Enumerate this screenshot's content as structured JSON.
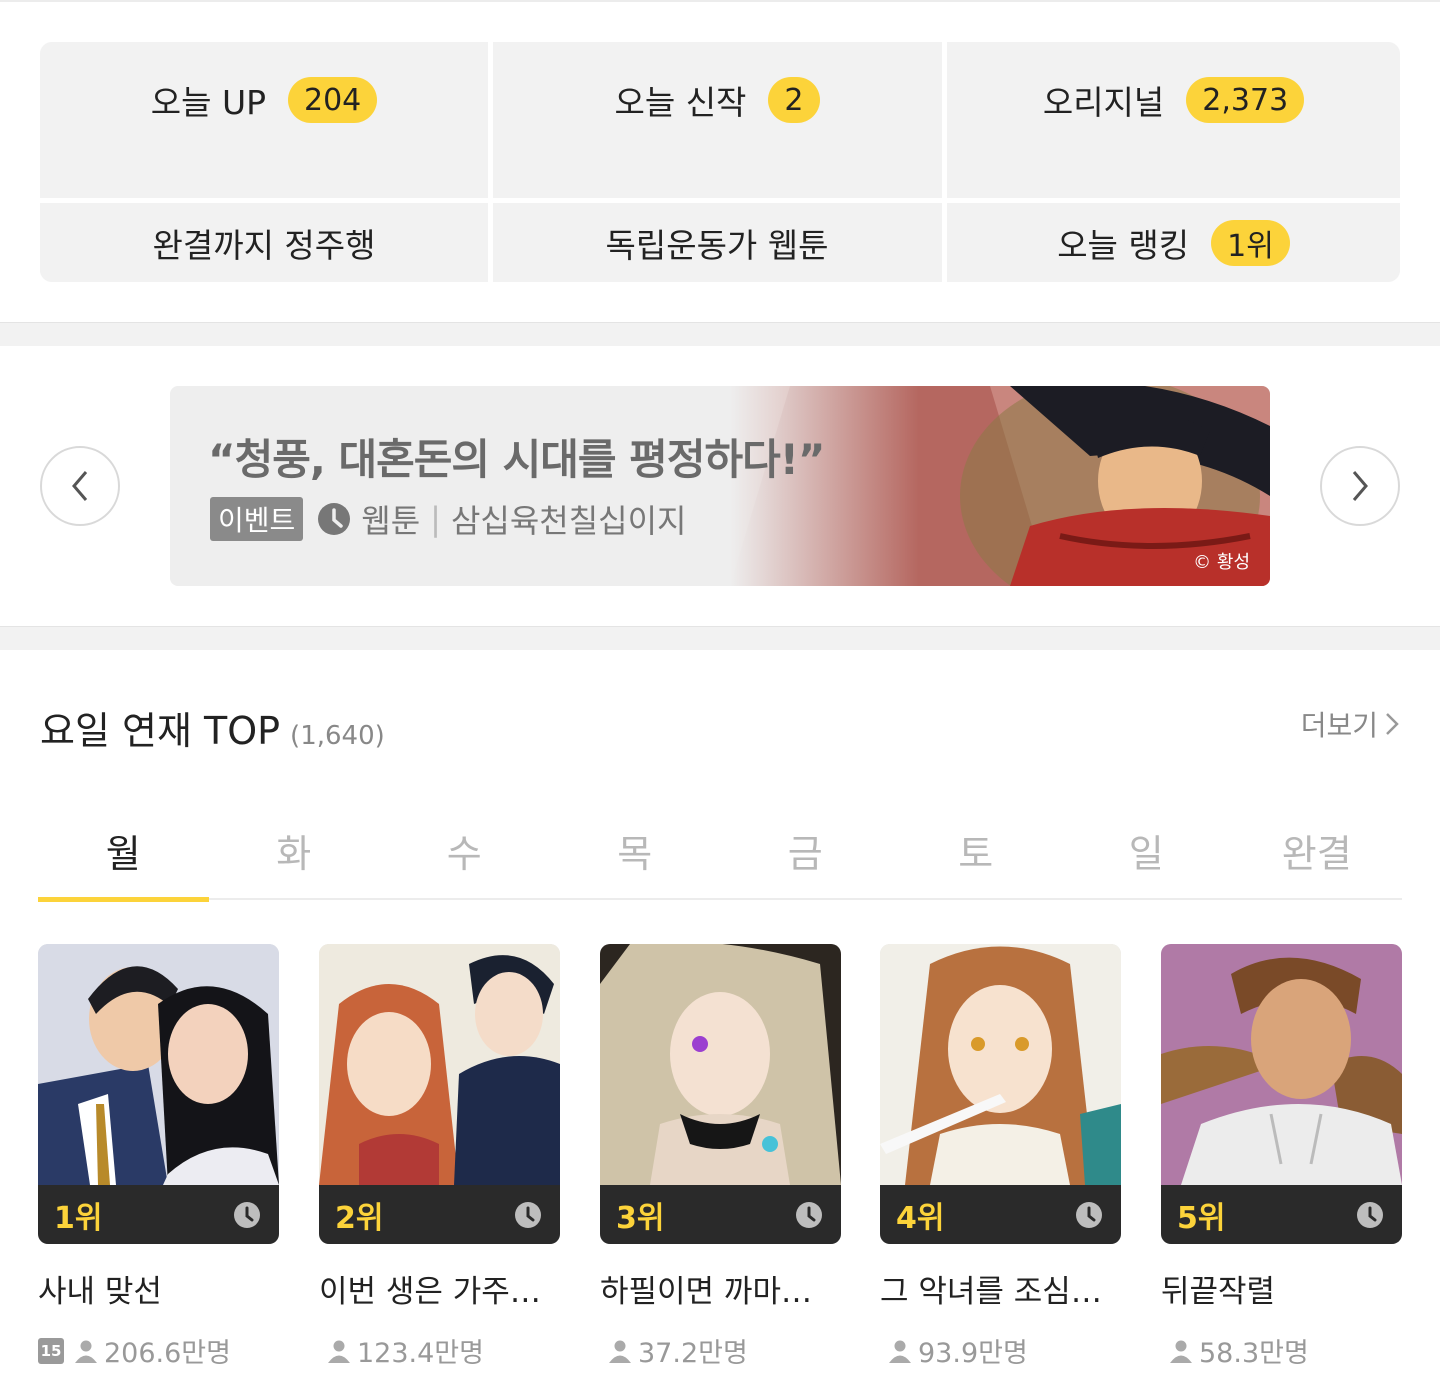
{
  "quick_menu": [
    {
      "label": "오늘 UP",
      "badge": "204"
    },
    {
      "label": "오늘 신작",
      "badge": "2"
    },
    {
      "label": "오리지널",
      "badge": "2,373"
    },
    {
      "label": "완결까지 정주행",
      "badge": ""
    },
    {
      "label": "독립운동가 웹툰",
      "badge": ""
    },
    {
      "label": "오늘 랭킹",
      "badge": "1위"
    }
  ],
  "banner": {
    "title": "“청풍, 대혼돈의 시대를 평정하다!”",
    "tag": "이벤트",
    "category": "웹툰",
    "separator": "|",
    "author": "삼십육천칠십이지",
    "credit": "© 황성",
    "prev_icon": "chevron-left-icon",
    "next_icon": "chevron-right-icon"
  },
  "section": {
    "title": "요일 연재 TOP",
    "count": "(1,640)",
    "more_label": "더보기"
  },
  "tabs": [
    {
      "label": "월",
      "active": true
    },
    {
      "label": "화",
      "active": false
    },
    {
      "label": "수",
      "active": false
    },
    {
      "label": "목",
      "active": false
    },
    {
      "label": "금",
      "active": false
    },
    {
      "label": "토",
      "active": false
    },
    {
      "label": "일",
      "active": false
    },
    {
      "label": "완결",
      "active": false
    }
  ],
  "cards": [
    {
      "rank": "1위",
      "title": "사내 맞선",
      "age": "15",
      "views": "206.6만명"
    },
    {
      "rank": "2위",
      "title": "이번 생은 가주…",
      "age": "",
      "views": "123.4만명"
    },
    {
      "rank": "3위",
      "title": "하필이면 까마…",
      "age": "",
      "views": "37.2만명"
    },
    {
      "rank": "4위",
      "title": "그 악녀를 조심…",
      "age": "",
      "views": "93.9만명"
    },
    {
      "rank": "5위",
      "title": "뒤끝작렬",
      "age": "",
      "views": "58.3만명"
    }
  ],
  "colors": {
    "accent": "#fcd33a",
    "rank_bar": "#2a2a2a",
    "panel": "#f2f2f2"
  }
}
